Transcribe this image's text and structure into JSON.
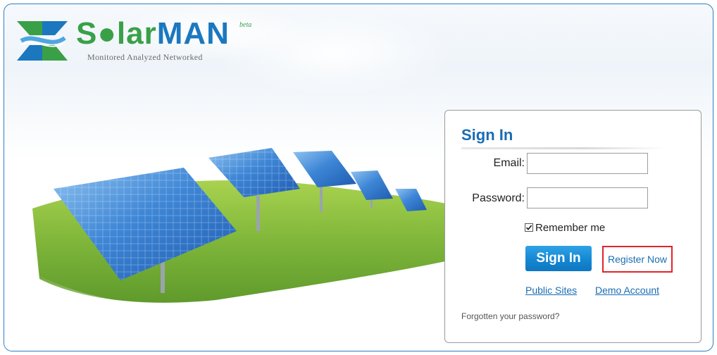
{
  "brand": {
    "name_part1": "S●lar",
    "name_part2": "MAN",
    "beta": "beta",
    "tagline": "Monitored Analyzed Networked"
  },
  "login": {
    "title": "Sign In",
    "email_label": "Email:",
    "email_value": "",
    "password_label": "Password:",
    "password_value": "",
    "remember_label": "Remember me",
    "remember_checked": true,
    "signin_label": "Sign In",
    "register_label": "Register Now",
    "public_sites_label": "Public Sites",
    "demo_account_label": "Demo Account",
    "forgot_label": "Forgotten your password?"
  },
  "colors": {
    "brand_blue": "#1b78bf",
    "brand_green": "#3aa048",
    "link_blue": "#1a6db3",
    "highlight_red": "#e0232b",
    "button_blue": "#1487d3"
  },
  "icons": {
    "logo": "solarman-logo-icon",
    "checkbox": "checkmark-icon"
  }
}
